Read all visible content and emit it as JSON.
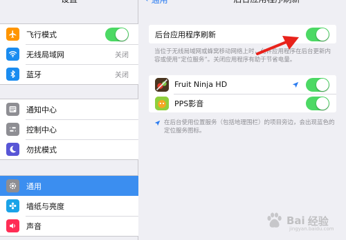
{
  "left_pane": {
    "header_title": "设置",
    "group1": [
      {
        "label": "飞行模式",
        "icon": "airplane-icon",
        "icon_color": "#ff9500",
        "control": "toggle"
      },
      {
        "label": "无线局域网",
        "icon": "wifi-icon",
        "icon_color": "#1a8cf0",
        "value": "关闭"
      },
      {
        "label": "蓝牙",
        "icon": "bluetooth-icon",
        "icon_color": "#1a8cf0",
        "value": "关闭"
      }
    ],
    "group2": [
      {
        "label": "通知中心",
        "icon": "notification-center-icon",
        "icon_color": "#8e8e93"
      },
      {
        "label": "控制中心",
        "icon": "control-center-icon",
        "icon_color": "#8e8e93"
      },
      {
        "label": "勿扰模式",
        "icon": "moon-icon",
        "icon_color": "#5856d6"
      }
    ],
    "group3": [
      {
        "label": "通用",
        "icon": "gear-icon",
        "icon_color": "#8e8e93",
        "selected": true
      },
      {
        "label": "墙纸与亮度",
        "icon": "wallpaper-icon",
        "icon_color": "#1aa3e8"
      },
      {
        "label": "声音",
        "icon": "sound-icon",
        "icon_color": "#ff2d55"
      }
    ]
  },
  "right_pane": {
    "back_label": "通用",
    "title": "后台应用程序刷新",
    "master_row": {
      "label": "后台应用程序刷新",
      "on": true
    },
    "master_footnote": "当位于无线局域网或蜂窝移动网络上时，允许应用程序在后台更新内容或使用“定位服务”。关闭应用程序有助于节省电量。",
    "apps": [
      {
        "name": "Fruit Ninja HD",
        "icon": "fruit-ninja-icon",
        "uses_location": true,
        "on": true
      },
      {
        "name": "PPS影音",
        "icon": "pps-icon",
        "uses_location": false,
        "on": true
      }
    ],
    "location_footnote": "在后台使用位置服务（包括地理围栏）的项目旁边，会出现蓝色的定位服务图标。"
  },
  "colors": {
    "accent": "#3b8ef0",
    "toggle_on": "#4cd964",
    "annotation": "#e8221b"
  },
  "watermark": {
    "brand": "Bai",
    "brand2": "经验",
    "sub": "jingyan.baidu.com"
  }
}
